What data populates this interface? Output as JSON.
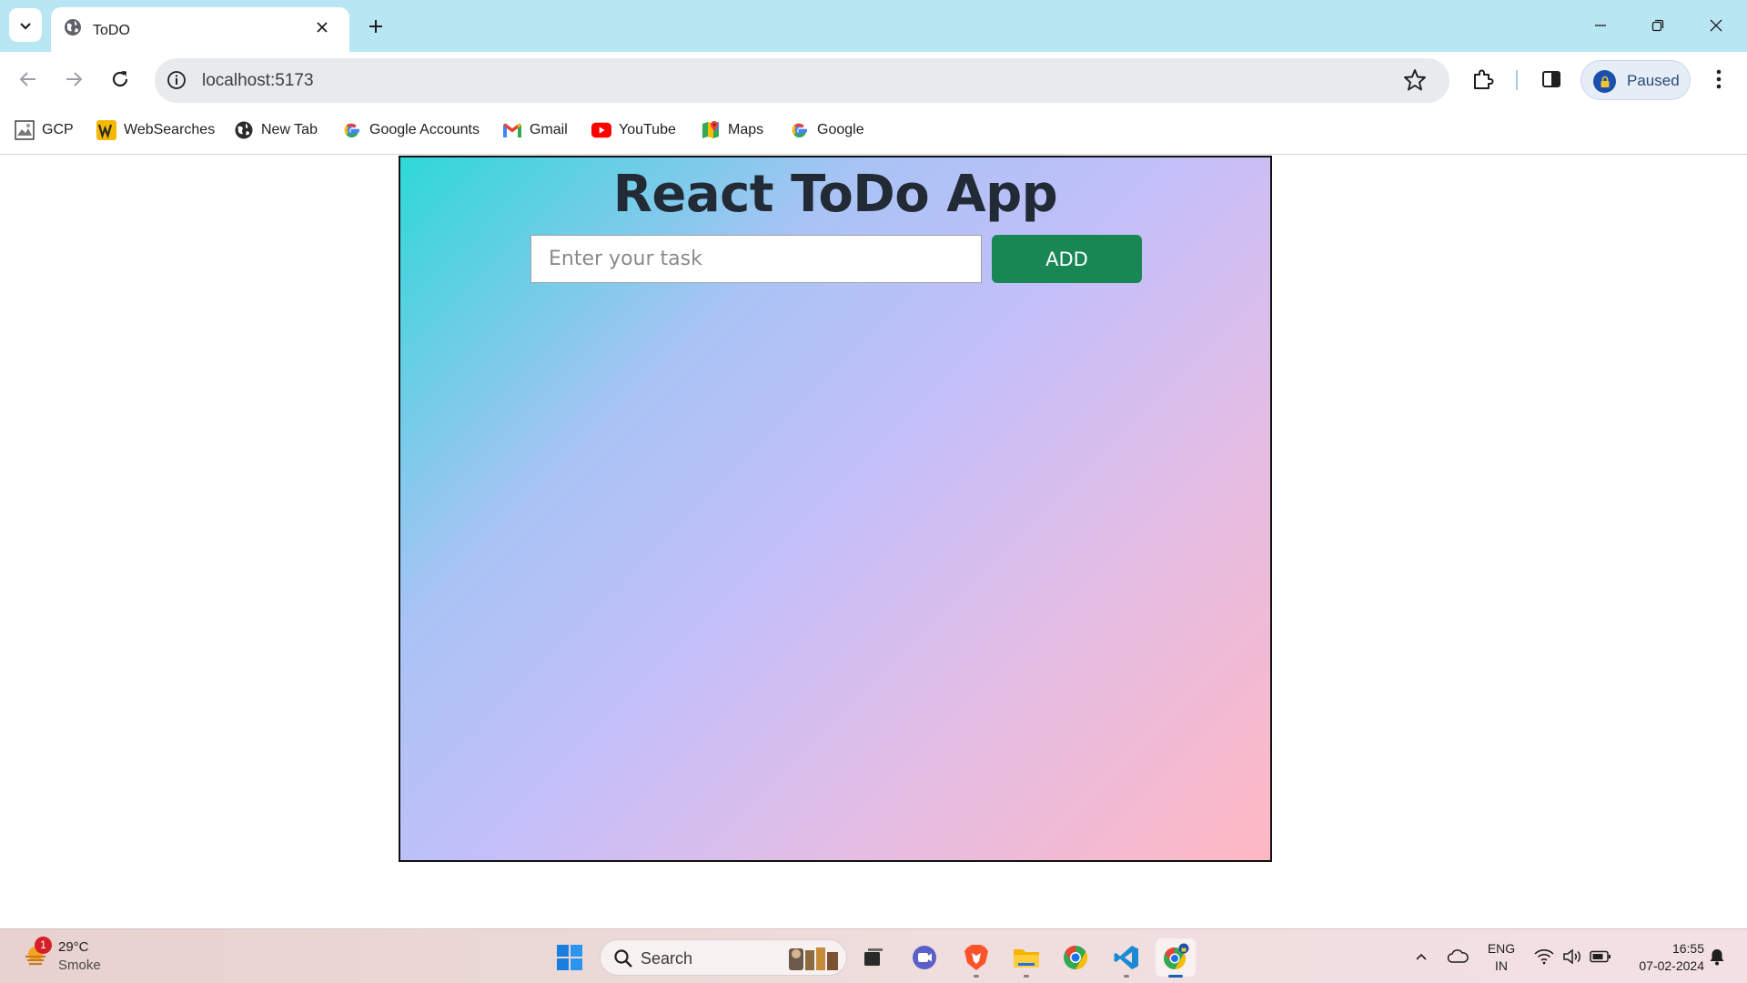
{
  "browser": {
    "tab": {
      "title": "ToDO"
    },
    "address_bar": {
      "url": "localhost:5173"
    },
    "profile": {
      "label": "Paused"
    }
  },
  "bookmarks": [
    {
      "label": "GCP",
      "icon": "gcp-icon"
    },
    {
      "label": "WebSearches",
      "icon": "websearches-icon"
    },
    {
      "label": "New Tab",
      "icon": "globe-icon"
    },
    {
      "label": "Google Accounts",
      "icon": "google-icon"
    },
    {
      "label": "Gmail",
      "icon": "gmail-icon"
    },
    {
      "label": "YouTube",
      "icon": "youtube-icon"
    },
    {
      "label": "Maps",
      "icon": "maps-icon"
    },
    {
      "label": "Google",
      "icon": "google-icon"
    }
  ],
  "app": {
    "title": "React ToDo App",
    "input_placeholder": "Enter your task",
    "add_label": "ADD",
    "colors": {
      "button": "#198754",
      "gradient_start": "#2ed8d8",
      "gradient_mid": "#c4bff9",
      "gradient_end": "#ffb8c3"
    }
  },
  "taskbar": {
    "weather": {
      "temp": "29°C",
      "condition": "Smoke",
      "badge": "1"
    },
    "search_label": "Search",
    "language": {
      "line1": "ENG",
      "line2": "IN"
    },
    "clock": {
      "time": "16:55",
      "date": "07-02-2024"
    }
  }
}
